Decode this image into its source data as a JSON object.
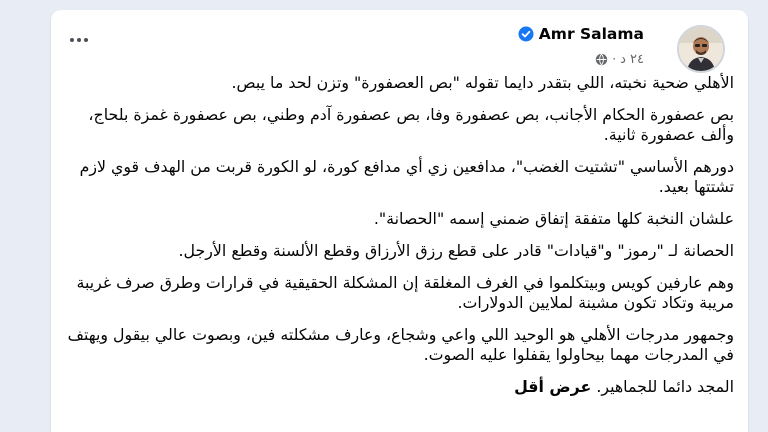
{
  "post": {
    "author_name": "Amr Salama",
    "time": "٢٤ د",
    "separator": "·",
    "paragraphs": [
      "الأهلي ضحية نخبته، اللي بتقدر دايما تقوله \"بص العصفورة\" وتزن لحد ما يبص.",
      "بص عصفورة الحكام الأجانب، بص عصفورة وفا، بص عصفورة آدم وطني، بص عصفورة غمزة بلحاج، وألف عصفورة ثانية.",
      "دورهم الأساسي \"تشتيت الغضب\"، مدافعين زي أي مدافع كورة، لو الكورة قربت من الهدف قوي لازم تشتتها بعيد.",
      "علشان النخبة كلها متفقة إتفاق ضمني إسمه \"الحصانة\".",
      "الحصانة لـ \"رموز\" و\"قيادات\" قادر على قطع رزق الأرزاق وقطع الألسنة وقطع الأرجل.",
      "وهم عارفين كويس وبيتكلموا في الغرف المغلقة إن المشكلة الحقيقية في قرارات وطرق صرف غريبة مريبة وتكاد تكون مشينة لملايين الدولارات.",
      "وجمهور مدرجات الأهلي هو الوحيد اللي واعي وشجاع، وعارف مشكلته فين، وبصوت عالي بيقول ويهتف في المدرجات مهما بيحاولوا يقفلوا عليه الصوت."
    ],
    "last_line": "المجد دائما للجماهير.",
    "see_less": "عرض أقل"
  },
  "icons": {
    "verified": "verified-badge-icon",
    "privacy": "globe-icon",
    "more": "more-options-icon",
    "avatar": "profile-avatar"
  },
  "colors": {
    "verified": "#1877f2",
    "meta_text": "#65676b",
    "body_text": "#050505",
    "background": "#e8edf5",
    "card": "#ffffff"
  }
}
